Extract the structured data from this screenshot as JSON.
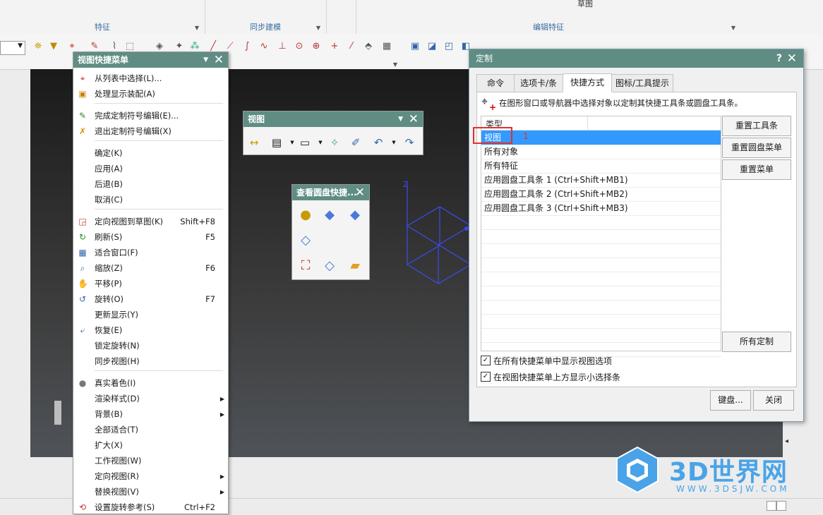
{
  "ribbon": {
    "top_labels": [
      "草图"
    ],
    "groups": [
      {
        "label": "特征"
      },
      {
        "label": "同步建模"
      },
      {
        "label": "编辑特征"
      }
    ]
  },
  "context_menu": {
    "title": "视图快捷菜单",
    "items": [
      {
        "icon": "crosshair-icon",
        "label": "从列表中选择(L)...",
        "shortcut": ""
      },
      {
        "icon": "assembly-icon",
        "label": "处理显示装配(A)",
        "shortcut": ""
      },
      {
        "icon": "symbol-edit-icon",
        "label": "完成定制符号编辑(E)...",
        "shortcut": ""
      },
      {
        "icon": "symbol-exit-icon",
        "label": "退出定制符号编辑(X)",
        "shortcut": ""
      },
      {
        "icon": "",
        "label": "确定(K)",
        "shortcut": ""
      },
      {
        "icon": "",
        "label": "应用(A)",
        "shortcut": ""
      },
      {
        "icon": "",
        "label": "后退(B)",
        "shortcut": ""
      },
      {
        "icon": "",
        "label": "取消(C)",
        "shortcut": ""
      },
      {
        "icon": "orient-view-icon",
        "label": "定向视图到草图(K)",
        "shortcut": "Shift+F8"
      },
      {
        "icon": "refresh-icon",
        "label": "刷新(S)",
        "shortcut": "F5"
      },
      {
        "icon": "fit-window-icon",
        "label": "适合窗口(F)",
        "shortcut": ""
      },
      {
        "icon": "zoom-icon",
        "label": "缩放(Z)",
        "shortcut": "F6"
      },
      {
        "icon": "pan-icon",
        "label": "平移(P)",
        "shortcut": ""
      },
      {
        "icon": "rotate-icon",
        "label": "旋转(O)",
        "shortcut": "F7"
      },
      {
        "icon": "",
        "label": "更新显示(Y)",
        "shortcut": ""
      },
      {
        "icon": "restore-icon",
        "label": "恢复(E)",
        "shortcut": ""
      },
      {
        "icon": "",
        "label": "锁定旋转(N)",
        "shortcut": ""
      },
      {
        "icon": "",
        "label": "同步视图(H)",
        "shortcut": ""
      },
      {
        "icon": "shaded-sphere-icon",
        "label": "真实着色(I)",
        "shortcut": ""
      },
      {
        "icon": "",
        "label": "渲染样式(D)",
        "shortcut": "",
        "submenu": true
      },
      {
        "icon": "",
        "label": "背景(B)",
        "shortcut": "",
        "submenu": true
      },
      {
        "icon": "",
        "label": "全部适合(T)",
        "shortcut": ""
      },
      {
        "icon": "",
        "label": "扩大(X)",
        "shortcut": ""
      },
      {
        "icon": "",
        "label": "工作视图(W)",
        "shortcut": ""
      },
      {
        "icon": "",
        "label": "定向视图(R)",
        "shortcut": "",
        "submenu": true
      },
      {
        "icon": "",
        "label": "替换视图(V)",
        "shortcut": "",
        "submenu": true
      },
      {
        "icon": "rotate-ref-icon",
        "label": "设置旋转参考(S)",
        "shortcut": "Ctrl+F2"
      }
    ]
  },
  "view_toolbar": {
    "title": "视图"
  },
  "pie_panel": {
    "title": "查看圆盘快捷..."
  },
  "dialog": {
    "title": "定制",
    "help": "?",
    "tabs": [
      {
        "label": "命令"
      },
      {
        "label": "选项卡/条"
      },
      {
        "label": "快捷方式"
      },
      {
        "label": "图标/工具提示"
      }
    ],
    "active_tab": "快捷方式",
    "instruction": "在图形窗口或导航器中选择对象以定制其快捷工具条或圆盘工具条。",
    "list_header": "类型",
    "list_items": [
      "视图",
      "所有对象",
      "所有特征",
      "应用圆盘工具条 1 (Ctrl+Shift+MB1)",
      "应用圆盘工具条 2 (Ctrl+Shift+MB2)",
      "应用圆盘工具条 3 (Ctrl+Shift+MB3)"
    ],
    "selected_index": 0,
    "annotation_number": "1",
    "buttons": {
      "reset_toolbar": "重置工具条",
      "reset_pie": "重置圆盘菜单",
      "reset_menu": "重置菜单",
      "all_custom": "所有定制",
      "keyboard": "键盘...",
      "close": "关闭"
    },
    "checkboxes": [
      {
        "label": "在所有快捷菜单中显示视图选项",
        "checked": true
      },
      {
        "label": "在视图快捷菜单上方显示小选择条",
        "checked": true
      }
    ]
  },
  "watermark": {
    "brand": "3D世界网",
    "url": "WWW.3DSJW.COM"
  },
  "colors": {
    "panel_title": "#5f8d83",
    "selection": "#3399ff",
    "annotation": "#e03030"
  }
}
